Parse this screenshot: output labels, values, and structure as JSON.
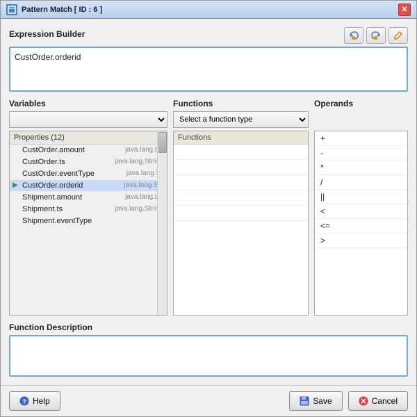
{
  "window": {
    "title": "Pattern Match [ ID : 6 ]",
    "icon": "⬛",
    "close_label": "✕"
  },
  "toolbar": {
    "btn1_icon": "↺",
    "btn2_icon": "↻",
    "btn3_icon": "✏"
  },
  "expression": {
    "label": "Expression Builder",
    "value": "CustOrder.orderid"
  },
  "variables": {
    "label": "Variables",
    "dropdown_placeholder": "",
    "list_header": "Properties (12)",
    "items": [
      {
        "name": "CustOrder.amount",
        "type": "java.lang.Lo"
      },
      {
        "name": "CustOrder.ts",
        "type": "java.lang.String"
      },
      {
        "name": "CustOrder.eventType",
        "type": "java.lang.St"
      },
      {
        "name": "CustOrder.orderid",
        "type": "java.lang.Str",
        "active": true
      },
      {
        "name": "Shipment.amount",
        "type": "java.lang.Lo"
      },
      {
        "name": "Shipment.ts",
        "type": "java.lang.String"
      },
      {
        "name": "Shipment.eventType",
        "type": ""
      }
    ]
  },
  "functions": {
    "label": "Functions",
    "dropdown_label": "Select a function type",
    "list_header": "Functions",
    "items": []
  },
  "operands": {
    "label": "Operands",
    "items": [
      "+",
      "-",
      "*",
      "/",
      "||",
      "<",
      "<=",
      ">"
    ]
  },
  "function_description": {
    "label": "Function Description"
  },
  "footer": {
    "help_label": "Help",
    "save_label": "Save",
    "cancel_label": "Cancel"
  }
}
